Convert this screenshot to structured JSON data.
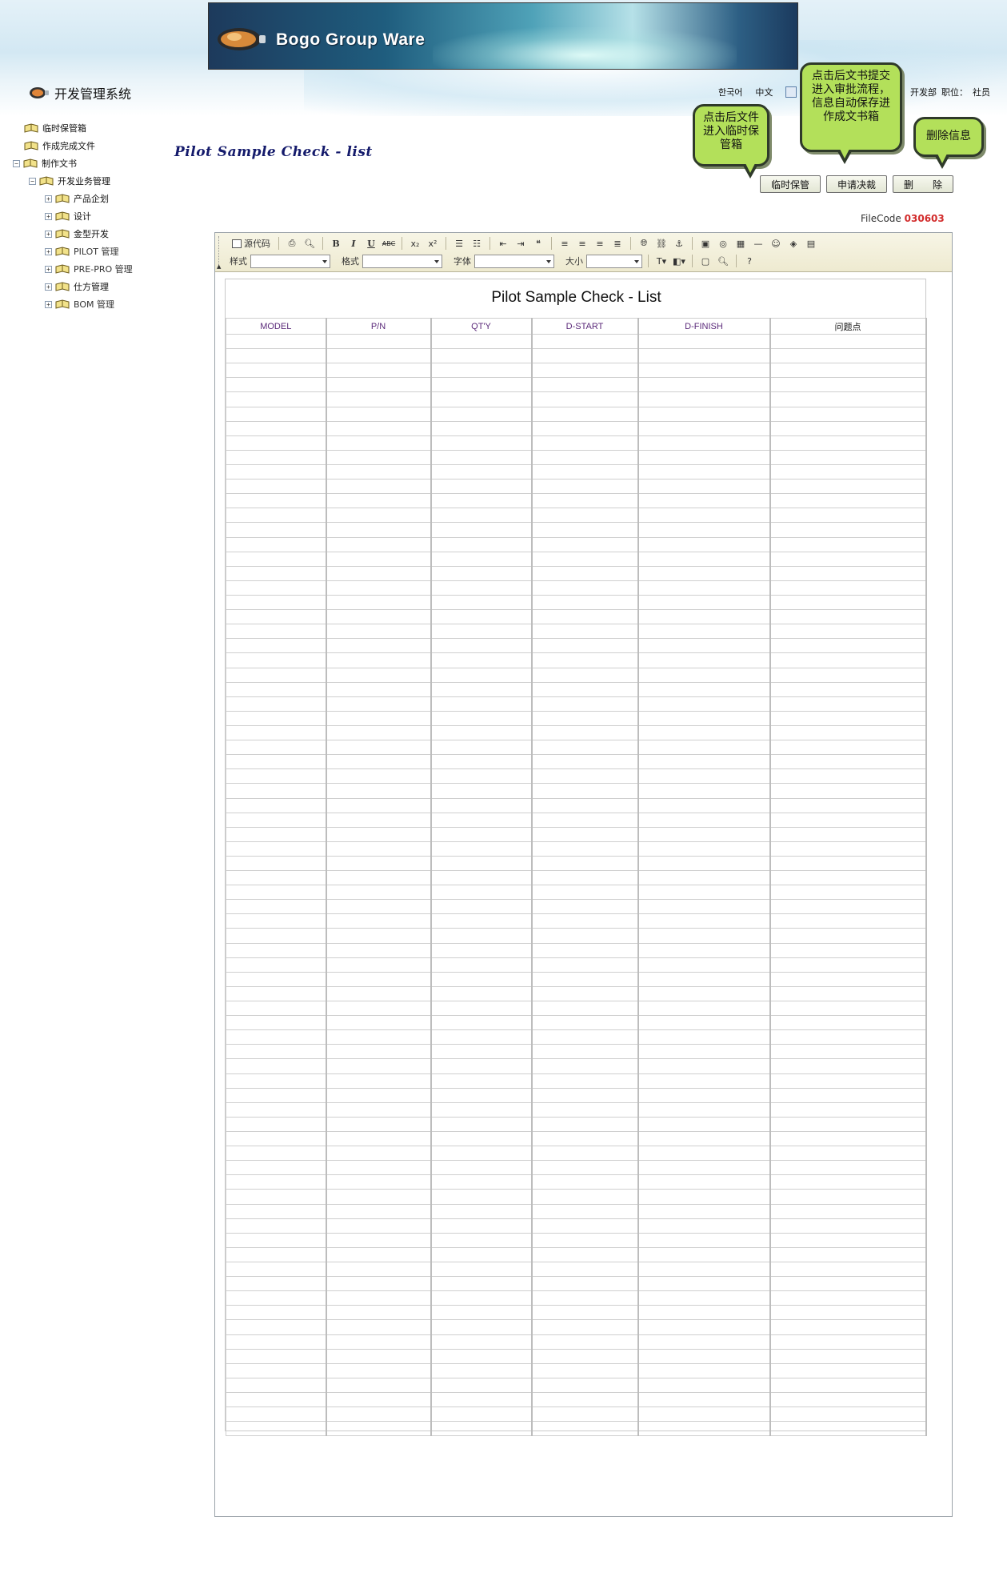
{
  "header": {
    "brand": "Bogo Group Ware",
    "system_title": "开发管理系统",
    "lang_korean": "한국어",
    "lang_chinese": "中文",
    "department": "开发部",
    "position_label": "职位：",
    "position_value": "社员"
  },
  "sidebar": {
    "items": [
      {
        "label": "临时保管箱"
      },
      {
        "label": "作成完成文件"
      },
      {
        "label": "制作文书",
        "expander": "−"
      },
      {
        "label": "开发业务管理",
        "expander": "−"
      },
      {
        "label": "产品企划",
        "expander": "+"
      },
      {
        "label": "设计",
        "expander": "+"
      },
      {
        "label": "金型开发",
        "expander": "+"
      },
      {
        "label": "PILOT 管理",
        "expander": "+"
      },
      {
        "label": "PRE-PRO 管理",
        "expander": "+"
      },
      {
        "label": "仕方管理",
        "expander": "+"
      },
      {
        "label": "BOM 管理",
        "expander": "+"
      }
    ]
  },
  "page": {
    "title": "Pilot Sample Check - list",
    "filecode_label": "FileCode",
    "filecode_value": "030603"
  },
  "callouts": {
    "temp_save": "点击后文件进入临时保管箱",
    "submit": "点击后文书提交进入审批流程，信息自动保存进作成文书箱",
    "delete": "删除信息"
  },
  "actions": {
    "temp_save": "临时保管",
    "submit": "申请决裁",
    "delete": "删　　除"
  },
  "toolbar": {
    "source": "源代码",
    "style_label": "样式",
    "format_label": "格式",
    "font_label": "字体",
    "size_label": "大小"
  },
  "document": {
    "title": "Pilot Sample Check - List",
    "columns": [
      "MODEL",
      "P/N",
      "QT'Y",
      "D-START",
      "D-FINISH",
      "问题点"
    ],
    "empty_rows": 76
  },
  "colors": {
    "callout": "#b3e05a",
    "filecode": "#d22b2b",
    "title": "#141a6b"
  }
}
